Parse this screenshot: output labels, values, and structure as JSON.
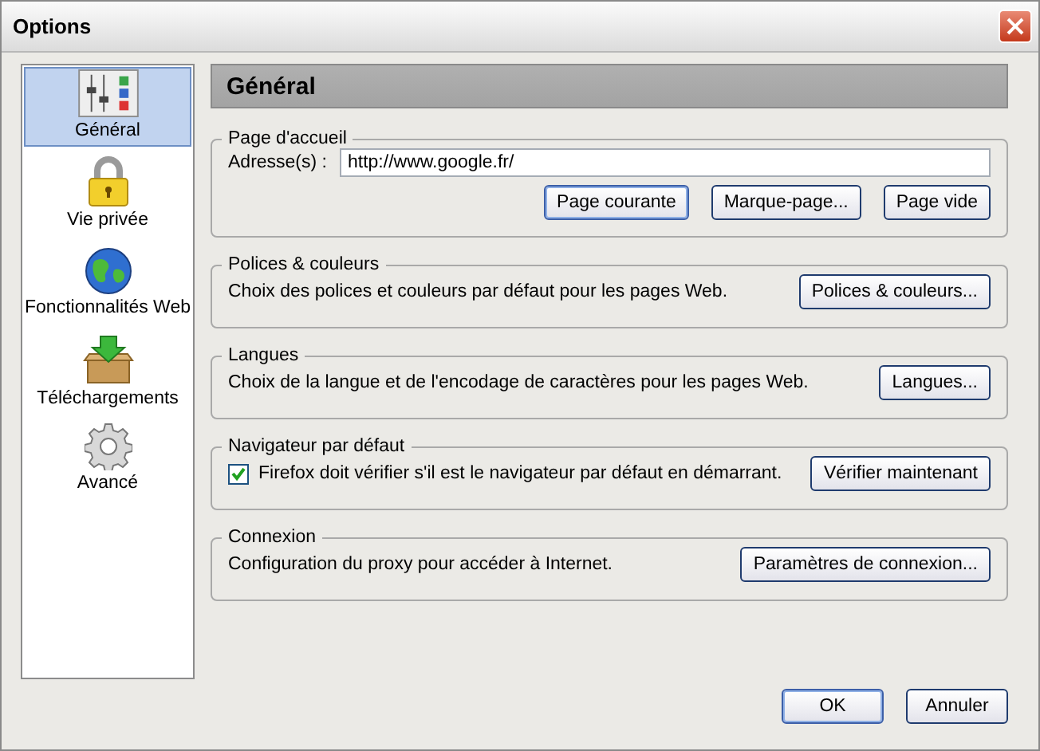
{
  "window": {
    "title": "Options"
  },
  "sidebar": {
    "items": [
      {
        "label": "Général",
        "selected": true
      },
      {
        "label": "Vie privée",
        "selected": false
      },
      {
        "label": "Fonctionnalités Web",
        "selected": false
      },
      {
        "label": "Téléchargements",
        "selected": false
      },
      {
        "label": "Avancé",
        "selected": false
      }
    ]
  },
  "panel": {
    "title": "Général"
  },
  "sections": [
    {
      "kind": "homepage",
      "title": "Page d'accueil",
      "field_label": "Adresse(s) :",
      "value": "http://www.google.fr/",
      "buttons": [
        {
          "label": "Page courante",
          "focused": true
        },
        {
          "label": "Marque-page...",
          "focused": false
        },
        {
          "label": "Page vide",
          "focused": false
        }
      ]
    },
    {
      "kind": "text",
      "title": "Polices & couleurs",
      "text": "Choix des polices et couleurs par défaut pour les pages Web.",
      "button": "Polices & couleurs..."
    },
    {
      "kind": "text",
      "title": "Langues",
      "text": "Choix de la langue et de l'encodage de caractères pour les pages Web.",
      "button": "Langues..."
    },
    {
      "kind": "checkbox",
      "title": "Navigateur par défaut",
      "checked": true,
      "text": "Firefox doit vérifier s'il est le navigateur par défaut en démarrant.",
      "button": "Vérifier maintenant"
    },
    {
      "kind": "text",
      "title": "Connexion",
      "text": "Configuration du proxy pour accéder à Internet.",
      "button": "Paramètres de connexion..."
    }
  ],
  "buttons": [
    {
      "label": "OK",
      "default": true
    },
    {
      "label": "Annuler",
      "default": false
    }
  ]
}
